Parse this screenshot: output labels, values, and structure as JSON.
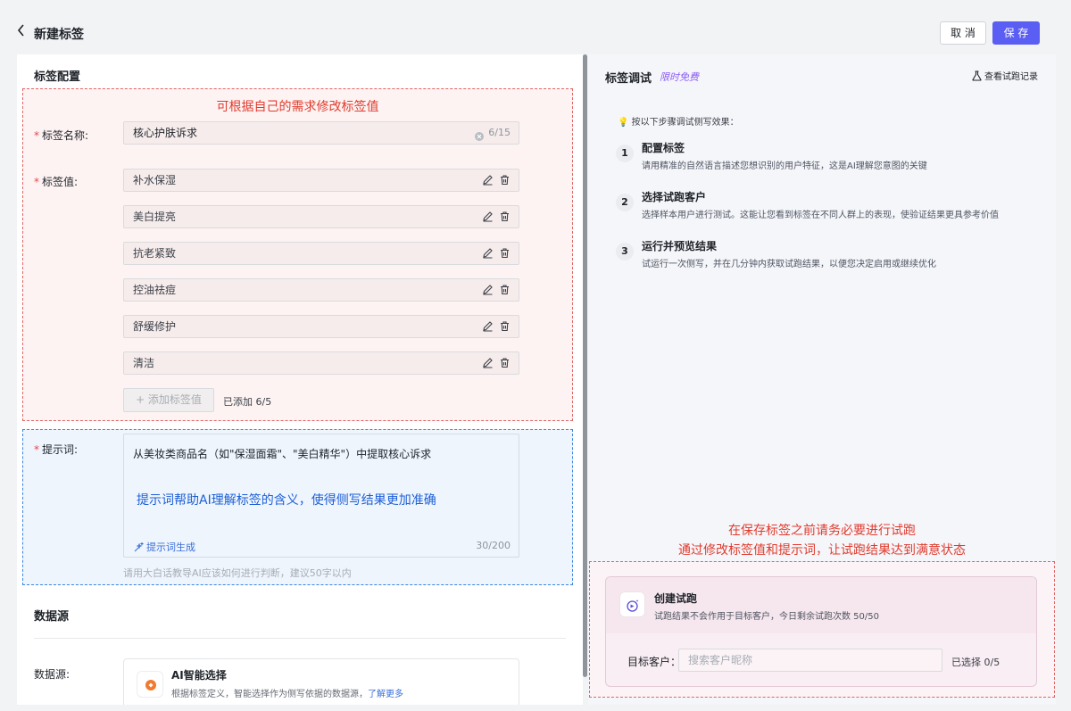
{
  "header": {
    "title": "新建标签",
    "cancel_label": "取 消",
    "save_label": "保 存"
  },
  "config": {
    "section_title": "标签配置",
    "annotation_top": "可根据自己的需求修改标签值",
    "name_label": "标签名称:",
    "name_value": "核心护肤诉求",
    "name_counter": "6/15",
    "values_label": "标签值:",
    "values": [
      "补水保湿",
      "美白提亮",
      "抗老紧致",
      "控油祛痘",
      "舒缓修护",
      "清洁"
    ],
    "add_label": "+ 添加标签值",
    "added_count": "已添加 6/5",
    "prompt_label": "提示词:",
    "prompt_value": "从美妆类商品名（如\"保湿面霜\"、\"美白精华\"）中提取核心诉求",
    "annotation_prompt": "提示词帮助AI理解标签的含义，使得侧写结果更加准确",
    "prompt_gen_label": "提示词生成",
    "prompt_counter": "30/200",
    "prompt_hint": "请用大白话教导AI应该如何进行判断，建议50字以内"
  },
  "datasource": {
    "section_title": "数据源",
    "label": "数据源:",
    "card_title": "AI智能选择",
    "card_desc": "根据标签定义，智能选择作为侧写依据的数据源，",
    "learn_more": "了解更多"
  },
  "debug": {
    "title": "标签调试",
    "badge": "限时免费",
    "history_label": "查看试跑记录",
    "tip": "💡 按以下步骤调试侧写效果：",
    "steps": [
      {
        "num": "1",
        "title": "配置标签",
        "desc": "请用精准的自然语言描述您想识别的用户特征，这是AI理解您意图的关键"
      },
      {
        "num": "2",
        "title": "选择试跑客户",
        "desc": "选择样本用户进行测试。这能让您看到标签在不同人群上的表现，使验证结果更具参考价值"
      },
      {
        "num": "3",
        "title": "运行并预览结果",
        "desc": "试运行一次侧写，并在几分钟内获取试跑结果，以便您决定启用或继续优化"
      }
    ],
    "annotation_line1": "在保存标签之前请务必要进行试跑",
    "annotation_line2": "通过修改标签值和提示词，让试跑结果达到满意状态",
    "trial_title": "创建试跑",
    "trial_desc": "试跑结果不会作用于目标客户，今日剩余试跑次数 50/50",
    "target_label": "目标客户：",
    "target_placeholder": "搜索客户昵称",
    "target_count": "已选择 0/5"
  },
  "colors": {
    "primary": "#5b5ef2",
    "annotation_red": "#e03b2d",
    "annotation_blue": "#1d5fd6",
    "badge_purple": "#8b5cf6"
  }
}
